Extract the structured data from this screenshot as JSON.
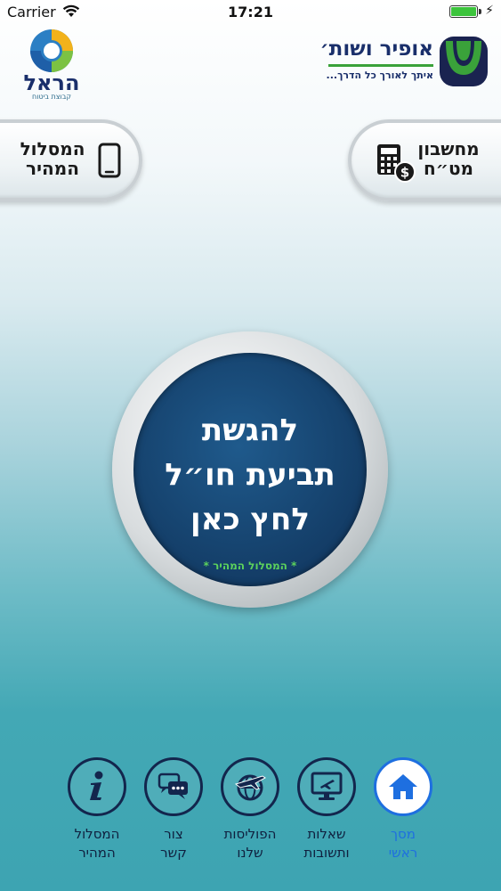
{
  "status_bar": {
    "carrier": "Carrier",
    "time": "17:21",
    "battery_level": 1.0
  },
  "header": {
    "ofir_name": "אופיר ושות׳",
    "ofir_tagline": "איתך לאורך כל הדרך...",
    "harel_name": "הראל",
    "harel_tagline": "קבוצת ביטוח"
  },
  "side_buttons": {
    "fast_track": "המסלול\nהמהיר",
    "fx_calculator": "מחשבון\nמט״ח"
  },
  "center_button": {
    "line1": "להגשת",
    "line2": "תביעת חו״ל",
    "line3": "לחץ כאן",
    "subtitle": "* המסלול המהיר *"
  },
  "bottom_nav": {
    "items": [
      {
        "label": "מסך\nראשי",
        "icon": "home-icon",
        "active": true
      },
      {
        "label": "שאלות\nותשובות",
        "icon": "monitor-plane-icon",
        "active": false
      },
      {
        "label": "הפוליסות\nשלנו",
        "icon": "globe-plane-icon",
        "active": false
      },
      {
        "label": "צור\nקשר",
        "icon": "chat-icon",
        "active": false
      },
      {
        "label": "המסלול\nהמהיר",
        "icon": "info-icon",
        "active": false
      }
    ]
  },
  "colors": {
    "navy": "#13264d",
    "active_blue": "#1e6fe0",
    "green": "#5cd25c",
    "disc": "#15416c"
  }
}
